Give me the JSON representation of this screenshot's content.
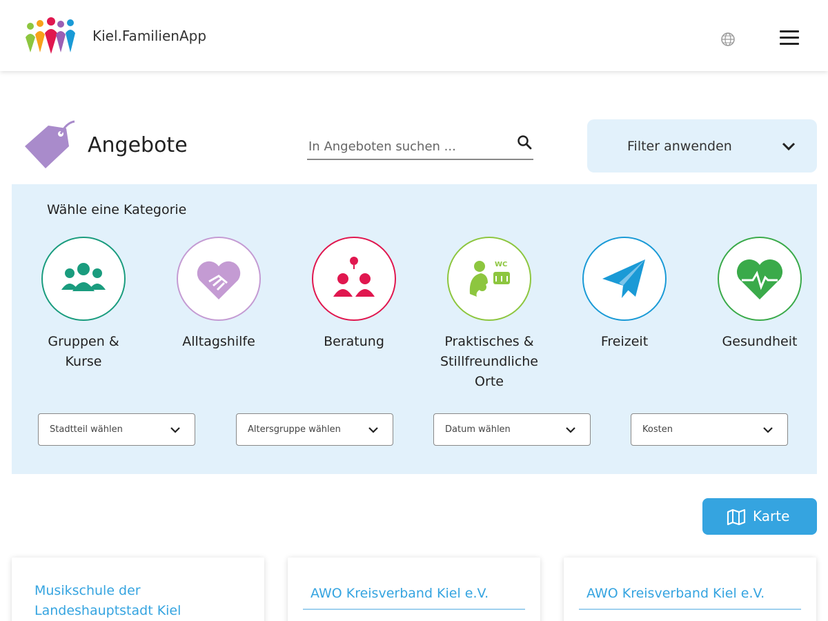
{
  "header": {
    "app_name": "Kiel.FamilienApp",
    "logo_icon": "family-people-logo",
    "language_icon": "globe-icon",
    "menu_icon": "hamburger-menu-icon"
  },
  "title_row": {
    "title": "Angebote",
    "title_icon": "price-tag-icon",
    "search": {
      "placeholder": "In Angeboten suchen ...",
      "value": "",
      "icon": "search-icon"
    },
    "filter_button": {
      "label": "Filter anwenden",
      "icon": "chevron-down-icon"
    }
  },
  "category_panel": {
    "heading": "Wähle eine Kategorie",
    "categories": [
      {
        "label": "Gruppen & Kurse",
        "icon": "group-people-icon",
        "color": "#1a9c7e"
      },
      {
        "label": "Alltagshilfe",
        "icon": "handshake-heart-icon",
        "color": "#c49bd3"
      },
      {
        "label": "Beratung",
        "icon": "consultation-icon",
        "color": "#e0174f"
      },
      {
        "label": "Praktisches & Stillfreundliche Orte",
        "icon": "breastfeeding-wc-diaper-icon",
        "color": "#8dc63f"
      },
      {
        "label": "Freizeit",
        "icon": "paper-plane-icon",
        "color": "#1a9ad6"
      },
      {
        "label": "Gesundheit",
        "icon": "heart-pulse-icon",
        "color": "#3aaa4a"
      }
    ],
    "filters": [
      {
        "label": "Stadtteil wählen"
      },
      {
        "label": "Altersgruppe wählen"
      },
      {
        "label": "Datum wählen"
      },
      {
        "label": "Kosten"
      }
    ]
  },
  "map_button": {
    "label": "Karte",
    "icon": "map-icon",
    "color": "#35a4e0"
  },
  "cards": [
    {
      "title": "Musikschule der Landeshauptstadt Kiel"
    },
    {
      "title": "AWO Kreisverband Kiel e.V."
    },
    {
      "title": "AWO Kreisverband Kiel e.V."
    }
  ]
}
